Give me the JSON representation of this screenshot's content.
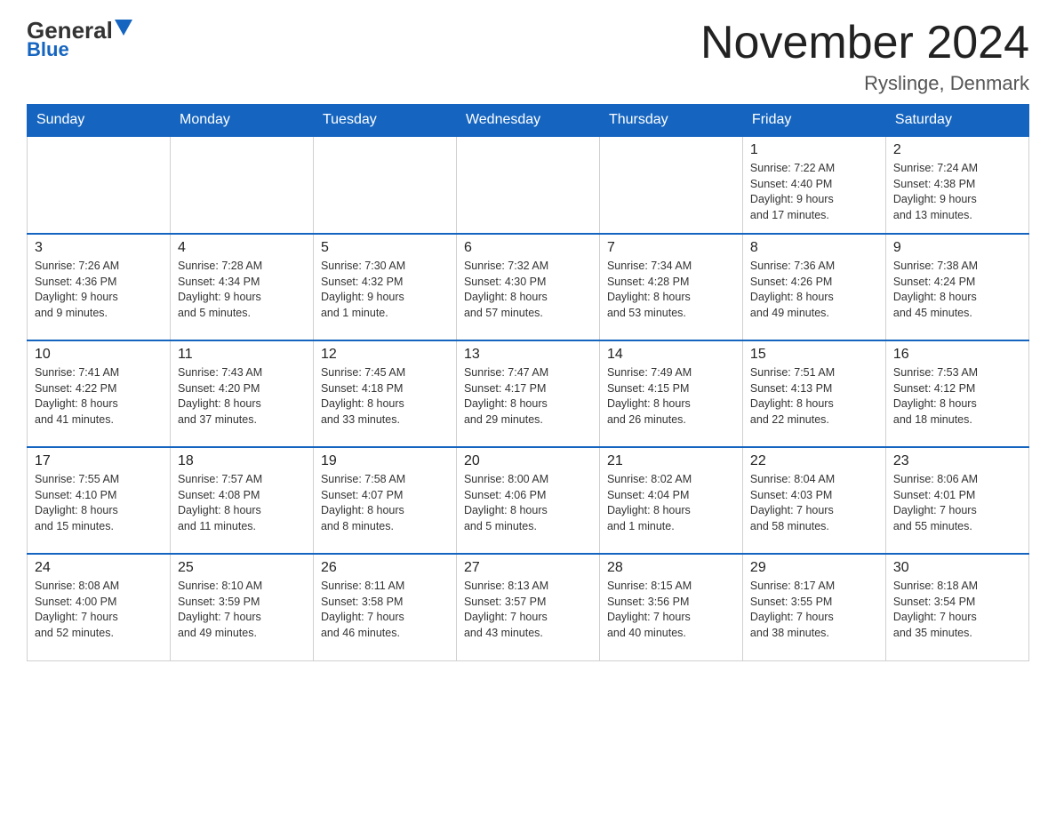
{
  "header": {
    "logo_general": "General",
    "logo_blue": "Blue",
    "month_title": "November 2024",
    "location": "Ryslinge, Denmark"
  },
  "calendar": {
    "days_of_week": [
      "Sunday",
      "Monday",
      "Tuesday",
      "Wednesday",
      "Thursday",
      "Friday",
      "Saturday"
    ],
    "weeks": [
      [
        {
          "day": "",
          "info": ""
        },
        {
          "day": "",
          "info": ""
        },
        {
          "day": "",
          "info": ""
        },
        {
          "day": "",
          "info": ""
        },
        {
          "day": "",
          "info": ""
        },
        {
          "day": "1",
          "info": "Sunrise: 7:22 AM\nSunset: 4:40 PM\nDaylight: 9 hours\nand 17 minutes."
        },
        {
          "day": "2",
          "info": "Sunrise: 7:24 AM\nSunset: 4:38 PM\nDaylight: 9 hours\nand 13 minutes."
        }
      ],
      [
        {
          "day": "3",
          "info": "Sunrise: 7:26 AM\nSunset: 4:36 PM\nDaylight: 9 hours\nand 9 minutes."
        },
        {
          "day": "4",
          "info": "Sunrise: 7:28 AM\nSunset: 4:34 PM\nDaylight: 9 hours\nand 5 minutes."
        },
        {
          "day": "5",
          "info": "Sunrise: 7:30 AM\nSunset: 4:32 PM\nDaylight: 9 hours\nand 1 minute."
        },
        {
          "day": "6",
          "info": "Sunrise: 7:32 AM\nSunset: 4:30 PM\nDaylight: 8 hours\nand 57 minutes."
        },
        {
          "day": "7",
          "info": "Sunrise: 7:34 AM\nSunset: 4:28 PM\nDaylight: 8 hours\nand 53 minutes."
        },
        {
          "day": "8",
          "info": "Sunrise: 7:36 AM\nSunset: 4:26 PM\nDaylight: 8 hours\nand 49 minutes."
        },
        {
          "day": "9",
          "info": "Sunrise: 7:38 AM\nSunset: 4:24 PM\nDaylight: 8 hours\nand 45 minutes."
        }
      ],
      [
        {
          "day": "10",
          "info": "Sunrise: 7:41 AM\nSunset: 4:22 PM\nDaylight: 8 hours\nand 41 minutes."
        },
        {
          "day": "11",
          "info": "Sunrise: 7:43 AM\nSunset: 4:20 PM\nDaylight: 8 hours\nand 37 minutes."
        },
        {
          "day": "12",
          "info": "Sunrise: 7:45 AM\nSunset: 4:18 PM\nDaylight: 8 hours\nand 33 minutes."
        },
        {
          "day": "13",
          "info": "Sunrise: 7:47 AM\nSunset: 4:17 PM\nDaylight: 8 hours\nand 29 minutes."
        },
        {
          "day": "14",
          "info": "Sunrise: 7:49 AM\nSunset: 4:15 PM\nDaylight: 8 hours\nand 26 minutes."
        },
        {
          "day": "15",
          "info": "Sunrise: 7:51 AM\nSunset: 4:13 PM\nDaylight: 8 hours\nand 22 minutes."
        },
        {
          "day": "16",
          "info": "Sunrise: 7:53 AM\nSunset: 4:12 PM\nDaylight: 8 hours\nand 18 minutes."
        }
      ],
      [
        {
          "day": "17",
          "info": "Sunrise: 7:55 AM\nSunset: 4:10 PM\nDaylight: 8 hours\nand 15 minutes."
        },
        {
          "day": "18",
          "info": "Sunrise: 7:57 AM\nSunset: 4:08 PM\nDaylight: 8 hours\nand 11 minutes."
        },
        {
          "day": "19",
          "info": "Sunrise: 7:58 AM\nSunset: 4:07 PM\nDaylight: 8 hours\nand 8 minutes."
        },
        {
          "day": "20",
          "info": "Sunrise: 8:00 AM\nSunset: 4:06 PM\nDaylight: 8 hours\nand 5 minutes."
        },
        {
          "day": "21",
          "info": "Sunrise: 8:02 AM\nSunset: 4:04 PM\nDaylight: 8 hours\nand 1 minute."
        },
        {
          "day": "22",
          "info": "Sunrise: 8:04 AM\nSunset: 4:03 PM\nDaylight: 7 hours\nand 58 minutes."
        },
        {
          "day": "23",
          "info": "Sunrise: 8:06 AM\nSunset: 4:01 PM\nDaylight: 7 hours\nand 55 minutes."
        }
      ],
      [
        {
          "day": "24",
          "info": "Sunrise: 8:08 AM\nSunset: 4:00 PM\nDaylight: 7 hours\nand 52 minutes."
        },
        {
          "day": "25",
          "info": "Sunrise: 8:10 AM\nSunset: 3:59 PM\nDaylight: 7 hours\nand 49 minutes."
        },
        {
          "day": "26",
          "info": "Sunrise: 8:11 AM\nSunset: 3:58 PM\nDaylight: 7 hours\nand 46 minutes."
        },
        {
          "day": "27",
          "info": "Sunrise: 8:13 AM\nSunset: 3:57 PM\nDaylight: 7 hours\nand 43 minutes."
        },
        {
          "day": "28",
          "info": "Sunrise: 8:15 AM\nSunset: 3:56 PM\nDaylight: 7 hours\nand 40 minutes."
        },
        {
          "day": "29",
          "info": "Sunrise: 8:17 AM\nSunset: 3:55 PM\nDaylight: 7 hours\nand 38 minutes."
        },
        {
          "day": "30",
          "info": "Sunrise: 8:18 AM\nSunset: 3:54 PM\nDaylight: 7 hours\nand 35 minutes."
        }
      ]
    ]
  }
}
